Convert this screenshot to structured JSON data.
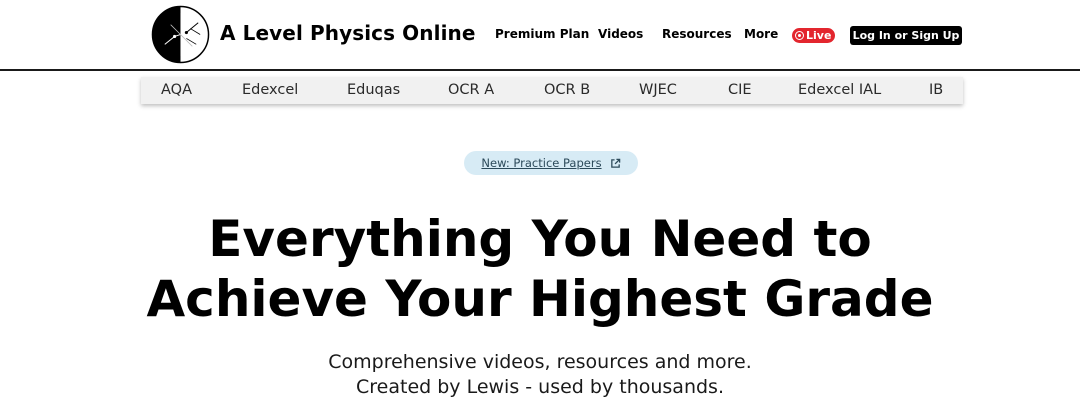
{
  "header": {
    "brand": "A Level Physics Online",
    "logo_icon": "physics-diagram-logo",
    "nav": {
      "premium": "Premium Plan",
      "videos": "Videos",
      "resources": "Resources",
      "more": "More"
    },
    "live_label": "Live",
    "live_color": "#e3262e",
    "login_label": "Log In or Sign Up"
  },
  "boards": [
    "AQA",
    "Edexcel",
    "Eduqas",
    "OCR A",
    "OCR B",
    "WJEC",
    "CIE",
    "Edexcel IAL",
    "IB"
  ],
  "banner": {
    "label": "New: Practice Papers",
    "icon": "external-link-icon",
    "bg_color": "#d7ebf5"
  },
  "hero": {
    "line1": "Everything You Need to",
    "line2": "Achieve Your Highest Grade",
    "sub1": "Comprehensive videos, resources and more.",
    "sub2": "Created by Lewis - used by thousands."
  }
}
